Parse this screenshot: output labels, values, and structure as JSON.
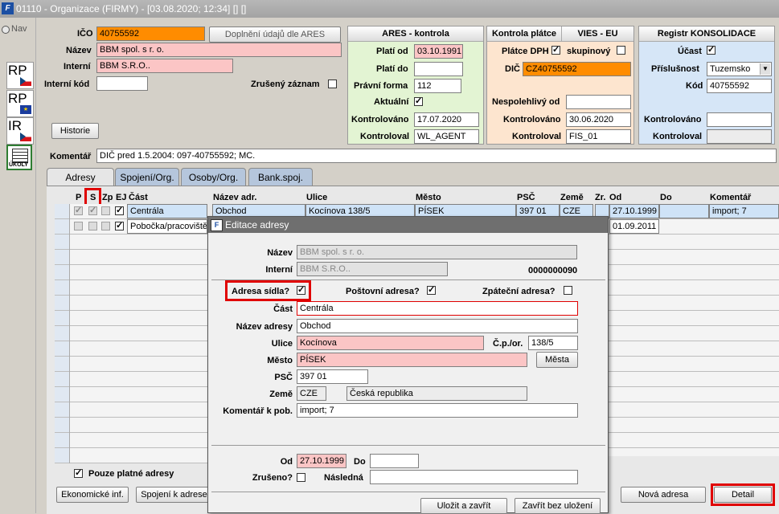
{
  "window": {
    "title": "01110 - Organizace (FIRMY) - [03.08.2020; 12:34]  []  []"
  },
  "nav": {
    "label": "Nav",
    "rp_cz": "RP",
    "rp_eu": "RP",
    "ir_cz": "IR",
    "ukoly": "ÚKOLY"
  },
  "header": {
    "ico_label": "IČO",
    "ico_value": "40755592",
    "ares_fill_button": "Doplnění údajů dle ARES",
    "nazev_label": "Název",
    "nazev_value": "BBM spol. s r. o.",
    "interni_label": "Interní",
    "interni_value": "BBM S.R.O..",
    "interni_kod_label": "Interní kód",
    "interni_kod_value": "",
    "zruseny_label": "Zrušený záznam",
    "historie_button": "Historie",
    "komentar_label": "Komentář",
    "komentar_value": "DIČ pred 1.5.2004: 097-40755592; MC."
  },
  "ares": {
    "title": "ARES - kontrola",
    "plati_od_label": "Platí od",
    "plati_od_value": "03.10.1991",
    "plati_do_label": "Platí do",
    "plati_do_value": "",
    "pravni_forma_label": "Právní forma",
    "pravni_forma_value": "112",
    "aktualni_label": "Aktuální",
    "kontrolovano_label": "Kontrolováno",
    "kontrolovano_value": "17.07.2020",
    "kontroloval_label": "Kontroloval",
    "kontroloval_value": "WL_AGENT"
  },
  "platce": {
    "title": "Kontrola plátce",
    "vies_title": "VIES - EU",
    "platce_dph_label": "Plátce DPH",
    "skupinovy_label": "skupinový",
    "dic_label": "DIČ",
    "dic_value": "CZ40755592",
    "nespolehlivy_label": "Nespolehlivý od",
    "nespolehlivy_value": "",
    "kontrolovano_label": "Kontrolováno",
    "kontrolovano_value": "30.06.2020",
    "kontroloval_label": "Kontroloval",
    "kontroloval_value": "FIS_01"
  },
  "konsolidace": {
    "title": "Registr KONSOLIDACE",
    "ucast_label": "Účast",
    "prislusnost_label": "Příslušnost",
    "prislusnost_value": "Tuzemsko",
    "kod_label": "Kód",
    "kod_value": "40755592",
    "kontrolovano_label": "Kontrolováno",
    "kontrolovano_value": "",
    "kontroloval_label": "Kontroloval",
    "kontroloval_value": ""
  },
  "tabs": [
    "Adresy",
    "Spojení/Org.",
    "Osoby/Org.",
    "Bank.spoj."
  ],
  "grid": {
    "headers": {
      "p": "P",
      "s": "S",
      "zp": "Zp",
      "ej": "EJ",
      "cast": "Část",
      "nazev": "Název adr.",
      "ulice": "Ulice",
      "mesto": "Město",
      "psc": "PSČ",
      "zeme": "Země",
      "zr": "Zr.",
      "od": "Od",
      "do": "Do",
      "komentar": "Komentář"
    },
    "rows": [
      {
        "cast": "Centrála",
        "nazev": "Obchod",
        "ulice": "Kocínova 138/5",
        "mesto": "PÍSEK",
        "psc": "397 01",
        "zeme": "CZE",
        "od": "27.10.1999",
        "do": "",
        "komentar": "import; 7"
      },
      {
        "cast": "Pobočka/pracoviště",
        "od": "01.09.2011"
      }
    ],
    "pouze_platne_label": "Pouze platné adresy"
  },
  "bottom": {
    "ekonomicke_button": "Ekonomické inf.",
    "spojeni_button": "Spojení k adrese",
    "nova_adresa_button": "Nová adresa",
    "detail_button": "Detail"
  },
  "dialog": {
    "title": "Editace adresy",
    "nazev_label": "Název",
    "nazev_value": "BBM spol. s r. o.",
    "interni_label": "Interní",
    "interni_value": "BBM S.R.O..",
    "code_value": "0000000090",
    "adresa_sidla_label": "Adresa sídla?",
    "postovni_label": "Poštovní adresa?",
    "zpatecni_label": "Zpáteční adresa?",
    "cast_label": "Část",
    "cast_value": "Centrála",
    "nazev_adresy_label": "Název adresy",
    "nazev_adresy_value": "Obchod",
    "ulice_label": "Ulice",
    "ulice_value": "Kocínova",
    "cp_label": "Č.p./or.",
    "cp_value": "138/5",
    "mesto_label": "Město",
    "mesto_value": "PÍSEK",
    "mesta_button": "Města",
    "psc_label": "PSČ",
    "psc_value": "397 01",
    "zeme_label": "Země",
    "zeme_code": "CZE",
    "zeme_name": "Česká republika",
    "komentar_label": "Komentář k pob.",
    "komentar_value": "import; 7",
    "od_label": "Od",
    "od_value": "27.10.1999",
    "do_label": "Do",
    "do_value": "",
    "zruseno_label": "Zrušeno?",
    "nasledna_label": "Následná",
    "nasledna_value": "",
    "ulozit_button": "Uložit a zavřít",
    "zavrit_button": "Zavřít bez uložení"
  }
}
